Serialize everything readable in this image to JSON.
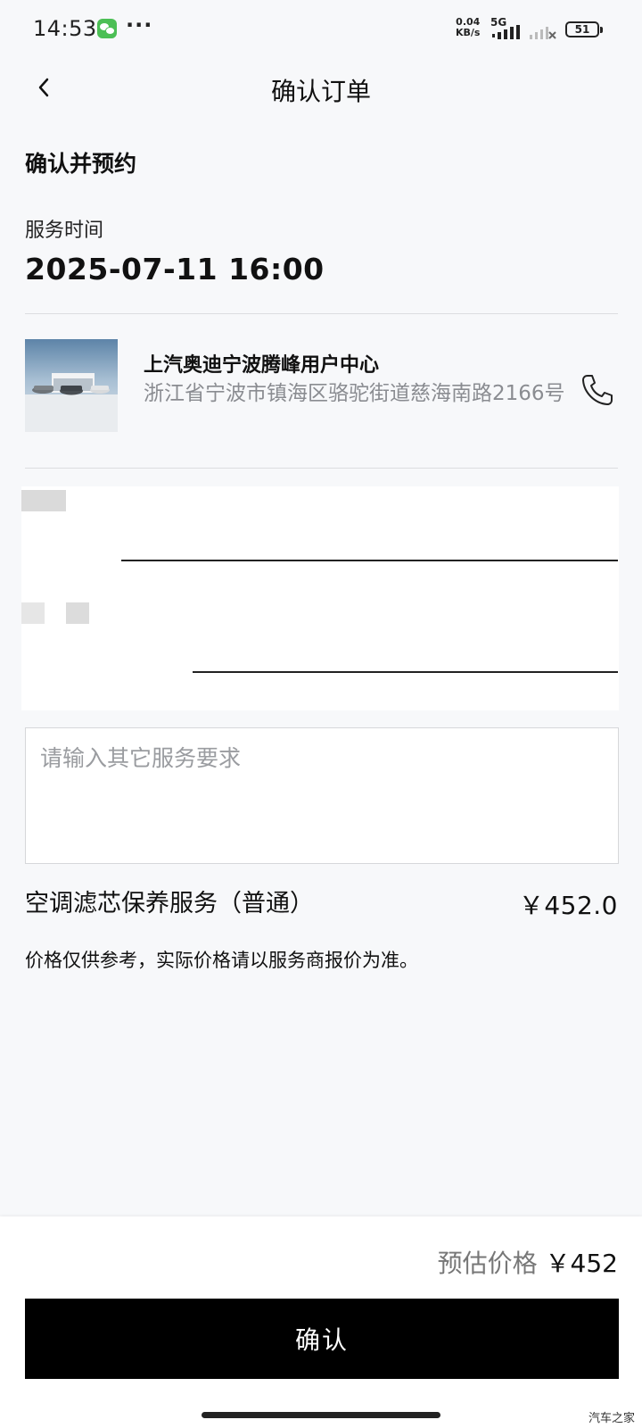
{
  "status_bar": {
    "time": "14:53",
    "more": "···",
    "speed_value": "0.04",
    "speed_unit": "KB/s",
    "network": "5G",
    "battery": "51"
  },
  "header": {
    "title": "确认订单",
    "back_icon": "chevron-left-icon"
  },
  "section_title": "确认并预约",
  "service_time": {
    "label": "服务时间",
    "value": "2025-07-11 16:00"
  },
  "dealer": {
    "name": "上汽奥迪宁波腾峰用户中心",
    "address": "浙江省宁波市镇海区骆驼街道慈海南路2166号",
    "phone_icon": "phone-icon"
  },
  "remarks": {
    "placeholder": "请输入其它服务要求",
    "value": ""
  },
  "service_item": {
    "name": "空调滤芯保养服务（普通）",
    "price": "￥452.0"
  },
  "price_note": "价格仅供参考，实际价格请以服务商报价为准。",
  "footer": {
    "estimate_label": "预估价格",
    "estimate_value": "￥452",
    "confirm_label": "确认"
  },
  "watermark": "汽车之家",
  "colors": {
    "background": "#f7f8fa",
    "button": "#000000",
    "muted_text": "#8a8c91",
    "wechat_green": "#4cbf55"
  }
}
